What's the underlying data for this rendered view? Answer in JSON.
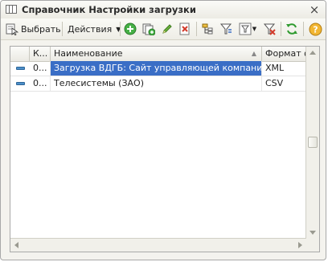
{
  "window": {
    "title": "Справочник Настройки загрузки"
  },
  "toolbar": {
    "select_label": "Выбрать",
    "actions_label": "Действия"
  },
  "table": {
    "columns": [
      {
        "label": "К..."
      },
      {
        "label": "Наименование"
      },
      {
        "label": "Формат ф"
      }
    ],
    "rows": [
      {
        "code": "0...",
        "name": "Загрузка ВДГБ: Сайт управляющей компании ...",
        "format": "XML",
        "selected": true
      },
      {
        "code": "0...",
        "name": "Телесистемы (ЗАО)",
        "format": "CSV",
        "selected": false
      }
    ]
  },
  "colors": {
    "selection": "#3a6ec6",
    "accent_green": "#3fa63f",
    "accent_red": "#d23a2a"
  }
}
